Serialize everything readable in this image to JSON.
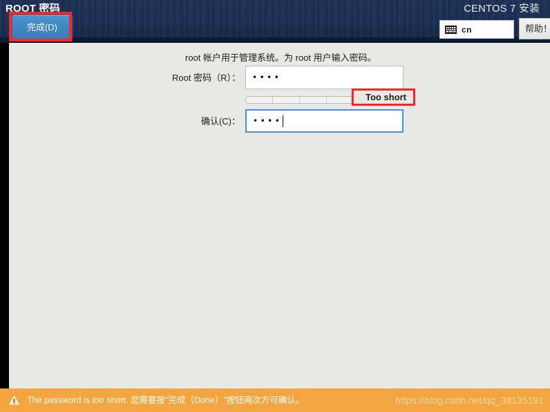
{
  "header": {
    "page_title": "ROOT 密码",
    "done_label": "完成(D)",
    "install_title": "CENTOS 7 安装",
    "keyboard_layout": "cn",
    "keyboard_icon": "keyboard-icon",
    "help_label": "帮助！"
  },
  "main": {
    "description": "root 帐户用于管理系统。为 root 用户输入密码。",
    "password": {
      "label": "Root 密码（R）：",
      "value": "••••"
    },
    "confirm": {
      "label": "确认(C)：",
      "value": "••••"
    },
    "strength": {
      "text": "Too short",
      "segments": 4,
      "filled": 0
    }
  },
  "bottom": {
    "warning_icon": "warning-triangle-icon",
    "warning_text": "The password is too short. 您需要按\"完成（Done）\"按钮两次方可确认。",
    "watermark": "https://blog.csdn.net/qq_38135191"
  },
  "colors": {
    "header_bg": "#1b2f52",
    "accent_blue": "#3f85c2",
    "annotation_red": "#fc2424",
    "warning_bar": "#f3a63f",
    "content_bg": "#e8e8e6"
  }
}
